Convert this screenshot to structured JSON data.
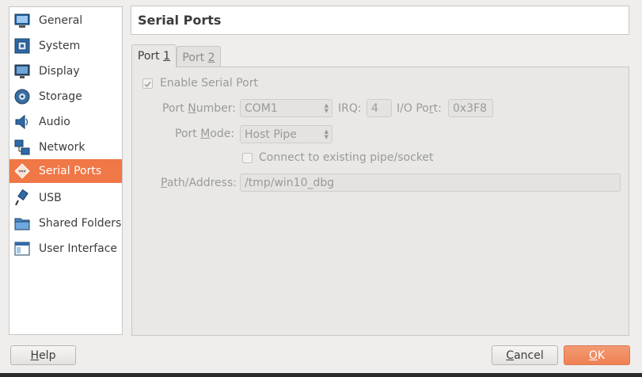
{
  "sidebar": {
    "items": [
      {
        "label": "General",
        "icon": "general-monitor-icon"
      },
      {
        "label": "System",
        "icon": "system-chip-icon"
      },
      {
        "label": "Display",
        "icon": "display-monitor-icon"
      },
      {
        "label": "Storage",
        "icon": "storage-disk-icon"
      },
      {
        "label": "Audio",
        "icon": "audio-speaker-icon"
      },
      {
        "label": "Network",
        "icon": "network-icon"
      },
      {
        "label": "Serial Ports",
        "icon": "serial-port-icon",
        "selected": true
      },
      {
        "label": "USB",
        "icon": "usb-icon"
      },
      {
        "label": "Shared Folders",
        "icon": "shared-folder-icon"
      },
      {
        "label": "User Interface",
        "icon": "user-interface-icon"
      }
    ]
  },
  "header": {
    "title": "Serial Ports"
  },
  "tabs": [
    {
      "label_pre": "Port ",
      "label_key": "1",
      "active": true
    },
    {
      "label_pre": "Port ",
      "label_key": "2",
      "active": false
    }
  ],
  "form": {
    "enable_label": "Enable Serial Port",
    "enable_checked": true,
    "port_number_label_pre": "Port ",
    "port_number_label_key": "N",
    "port_number_label_post": "umber:",
    "port_number_value": "COM1",
    "irq_label": "IRQ:",
    "irq_value": "4",
    "io_port_label_pre": "I/O Po",
    "io_port_label_key": "r",
    "io_port_label_post": "t:",
    "io_port_value": "0x3F8",
    "port_mode_label_pre": "Port ",
    "port_mode_label_key": "M",
    "port_mode_label_post": "ode:",
    "port_mode_value": "Host Pipe",
    "connect_label": "Connect to existing pipe/socket",
    "connect_checked": false,
    "path_label_pre": "",
    "path_label_key": "P",
    "path_label_post": "ath/Address:",
    "path_value": "/tmp/win10_dbg"
  },
  "buttons": {
    "help_key": "H",
    "help_rest": "elp",
    "cancel_key": "C",
    "cancel_rest": "ancel",
    "ok_key": "O",
    "ok_rest": "K"
  },
  "colors": {
    "accent": "#f07746",
    "disabled_text": "#9a9a9a"
  }
}
